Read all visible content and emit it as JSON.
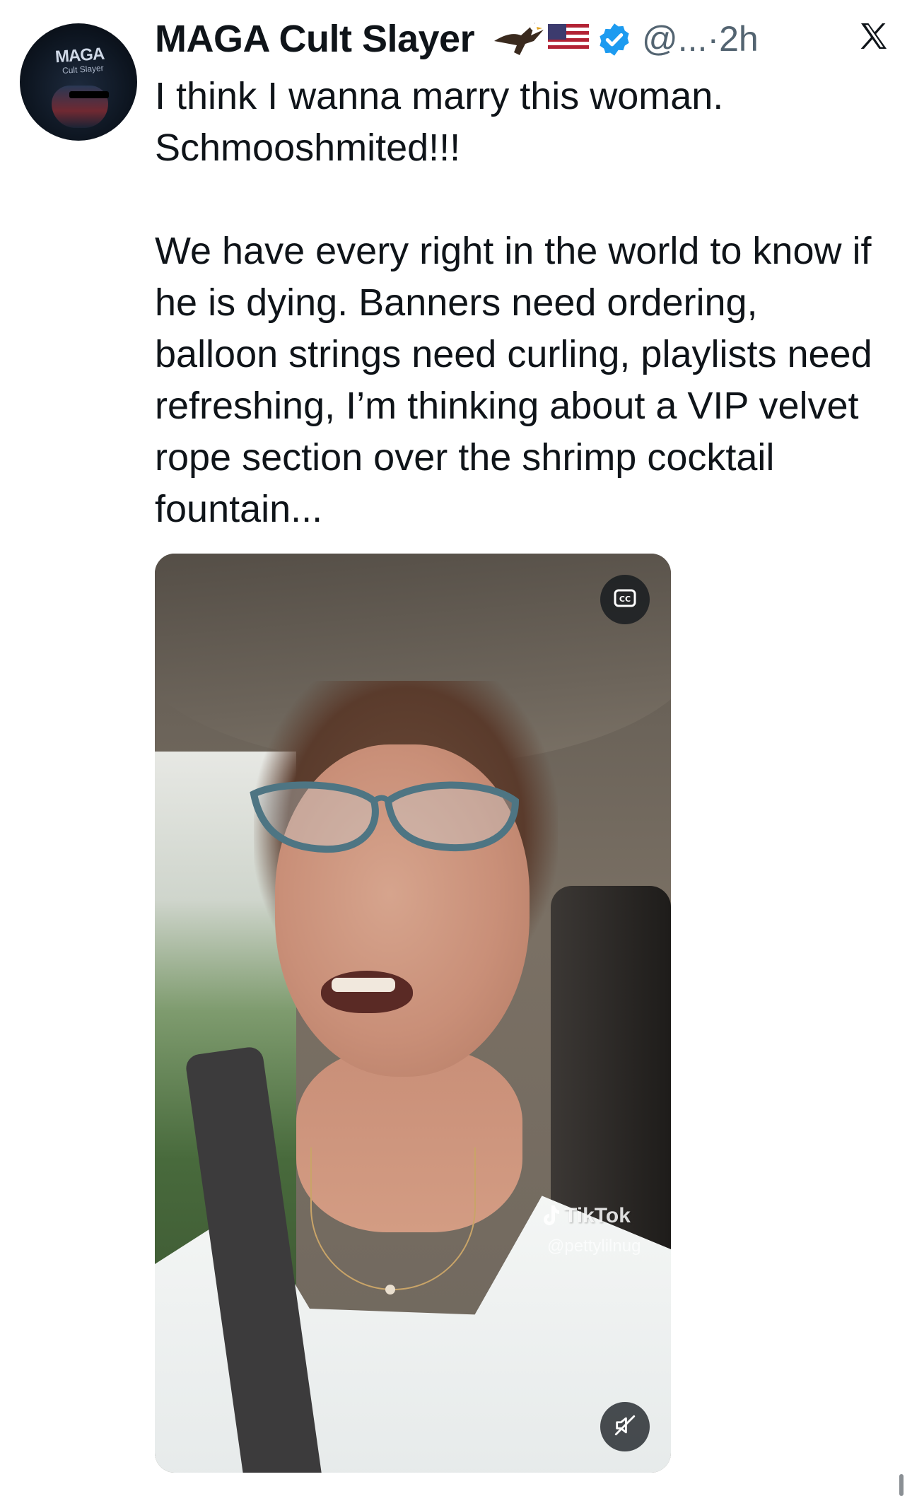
{
  "header": {
    "display_name": "MAGA Cult Slayer",
    "handle": "@...",
    "separator": "·",
    "time": "2h",
    "x_logo_label": "𝕏"
  },
  "avatar": {
    "cap_text": "MAGA",
    "cap_subtext": "Cult Slayer"
  },
  "tweet": {
    "text": "I think I wanna marry this woman.\nSchmooshmited!!!\n\nWe have every right in the world to know if he is dying. Banners need ordering, balloon strings need curling, playlists need refreshing, I’m thinking about a VIP velvet rope section over the shrimp cocktail fountain..."
  },
  "media": {
    "watermark_brand": "TikTok",
    "watermark_handle": "@pettylilnug"
  },
  "colors": {
    "text": "#0f1419",
    "secondary": "#536471",
    "verified": "#1d9bf0"
  }
}
